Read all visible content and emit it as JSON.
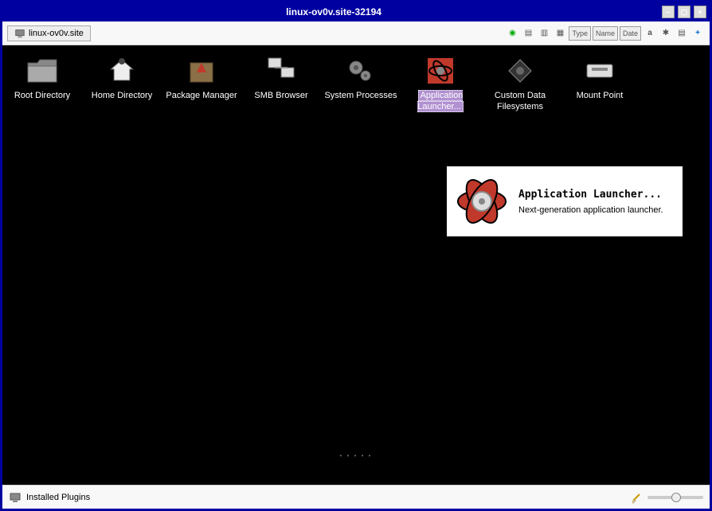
{
  "window": {
    "title": "linux-ov0v.site-32194",
    "tab_label": "linux-ov0v.site"
  },
  "toolbar": {
    "type_btn": "Type",
    "name_btn": "Name",
    "date_btn": "Date"
  },
  "icons": [
    {
      "label": "Root Directory",
      "glyph": "📁"
    },
    {
      "label": "Home Directory",
      "glyph": "🏠"
    },
    {
      "label": "Package Manager",
      "glyph": "⭐"
    },
    {
      "label": "SMB Browser",
      "glyph": "🖥"
    },
    {
      "label": "System Processes",
      "glyph": "⚙"
    },
    {
      "label": "Application Launcher...",
      "glyph": "⚛"
    },
    {
      "label": "Custom Data Filesystems",
      "glyph": "◈"
    },
    {
      "label": "Mount Point",
      "glyph": "💾"
    }
  ],
  "tooltip": {
    "title": "Application Launcher...",
    "description": "Next-generation application launcher."
  },
  "statusbar": {
    "label": "Installed Plugins"
  }
}
